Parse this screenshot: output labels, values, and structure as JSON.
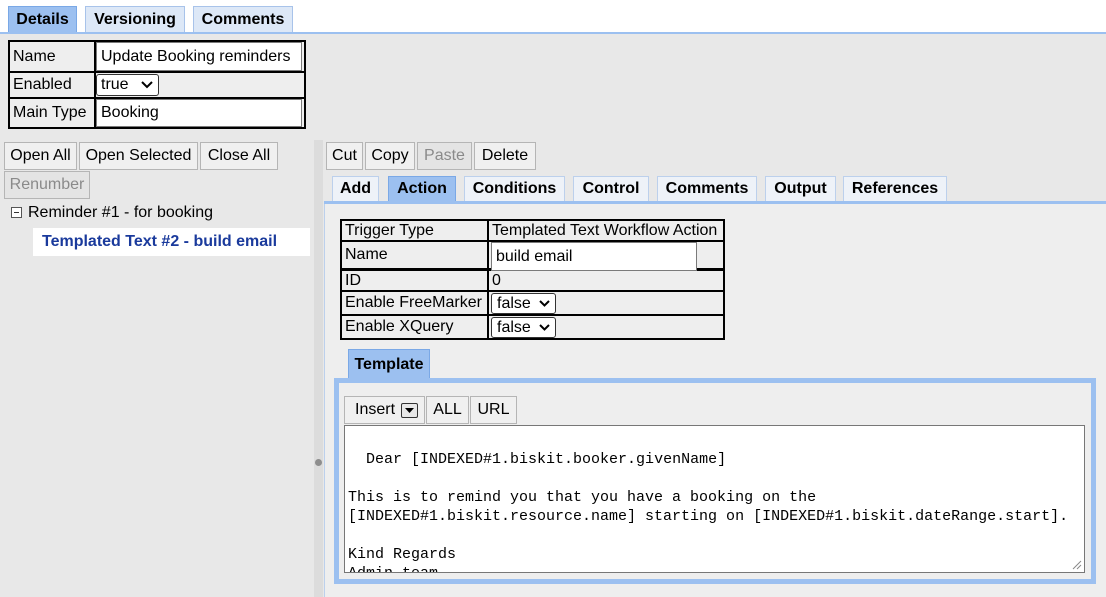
{
  "top_tabs": [
    {
      "label": "Details",
      "active": true
    },
    {
      "label": "Versioning",
      "active": false
    },
    {
      "label": "Comments",
      "active": false
    }
  ],
  "properties": {
    "name_label": "Name",
    "name_value": "Update Booking reminders",
    "enabled_label": "Enabled",
    "enabled_value": "true",
    "main_type_label": "Main Type",
    "main_type_value": "Booking"
  },
  "tree_toolbar": {
    "open_all": "Open All",
    "open_selected": "Open Selected",
    "close_all": "Close All",
    "renumber": "Renumber"
  },
  "tree": {
    "root_label": "Reminder #1 - for booking",
    "child_label": "Templated Text #2 - build email"
  },
  "edit_toolbar": {
    "cut": "Cut",
    "copy": "Copy",
    "paste": "Paste",
    "delete": "Delete"
  },
  "node_tabs": [
    {
      "label": "Add",
      "active": false
    },
    {
      "label": "Action",
      "active": true
    },
    {
      "label": "Conditions",
      "active": false
    },
    {
      "label": "Control",
      "active": false
    },
    {
      "label": "Comments",
      "active": false
    },
    {
      "label": "Output",
      "active": false
    },
    {
      "label": "References",
      "active": false
    }
  ],
  "action": {
    "trigger_type_label": "Trigger Type",
    "trigger_type_value": "Templated Text Workflow Action",
    "name_label": "Name",
    "name_value": "build email",
    "id_label": "ID",
    "id_value": "0",
    "freemarker_label": "Enable FreeMarker",
    "freemarker_value": "false",
    "xquery_label": "Enable XQuery",
    "xquery_value": "false"
  },
  "template": {
    "tab_label": "Template",
    "insert_label": "Insert",
    "all_label": "ALL",
    "url_label": "URL",
    "content": "Dear [INDEXED#1.biskit.booker.givenName]\n\nThis is to remind you that you have a booking on the\n[INDEXED#1.biskit.resource.name] starting on [INDEXED#1.biskit.dateRange.start].\n\nKind Regards\nAdmin team"
  },
  "colors": {
    "tab_active": "#9cc0f0",
    "tab_inactive": "#dde8f7",
    "selected_tree_text": "#1a3a9c",
    "panel_background": "#eeeeee"
  },
  "icons": {
    "tree_toggle": "collapse-minus-icon",
    "dropdown": "chevron-down-icon",
    "splitter": "splitter-handle-icon",
    "resize": "resize-grip-icon"
  }
}
